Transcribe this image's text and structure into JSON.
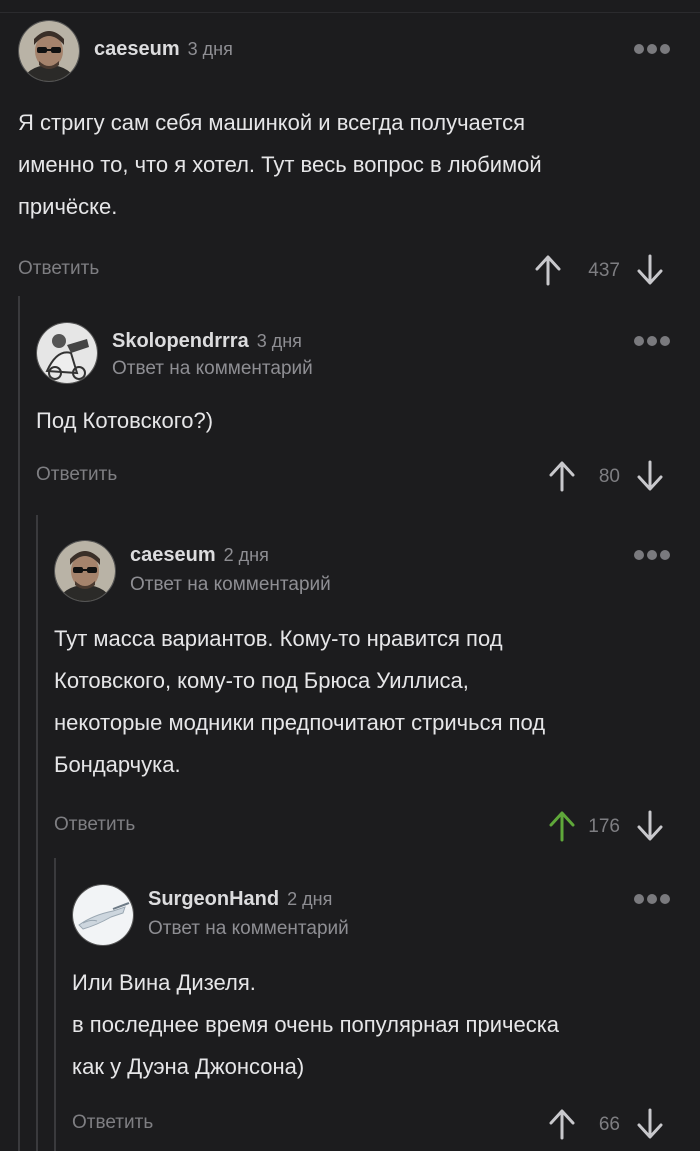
{
  "comments": [
    {
      "author": "caeseum",
      "date": "3 дня",
      "reply_to": "",
      "text": "Я стригу сам себя машинкой и всегда получается\nименно то, что я хотел. Тут весь вопрос в любимой\nпричёске.",
      "reply_label": "Ответить",
      "score": "437",
      "upvoted": false,
      "avatar": "man-sunglasses-avatar"
    },
    {
      "author": "Skolopendrrra",
      "date": "3 дня",
      "reply_to": "Ответ на комментарий",
      "text": "Под Котовского?)",
      "reply_label": "Ответить",
      "score": "80",
      "upvoted": false,
      "avatar": "person-bw-photo-avatar"
    },
    {
      "author": "caeseum",
      "date": "2 дня",
      "reply_to": "Ответ на комментарий",
      "text": "Тут масса вариантов. Кому-то нравится под\nКотовского, кому-то под Брюса Уиллиса,\nнекоторые модники предпочитают стричься под\nБондарчука.",
      "reply_label": "Ответить",
      "score": "176",
      "upvoted": true,
      "avatar": "man-sunglasses-avatar"
    },
    {
      "author": "SurgeonHand",
      "date": "2 дня",
      "reply_to": "Ответ на комментарий",
      "text": "Или Вина Дизеля.\nв последнее время очень популярная прическа\nкак у Дуэна Джонсона)",
      "reply_label": "Ответить",
      "score": "66",
      "upvoted": false,
      "avatar": "hand-scalpel-avatar"
    }
  ],
  "colors": {
    "background": "#1c1c1e",
    "upvote_active": "#5fa83a",
    "muted": "#7e7e82"
  }
}
